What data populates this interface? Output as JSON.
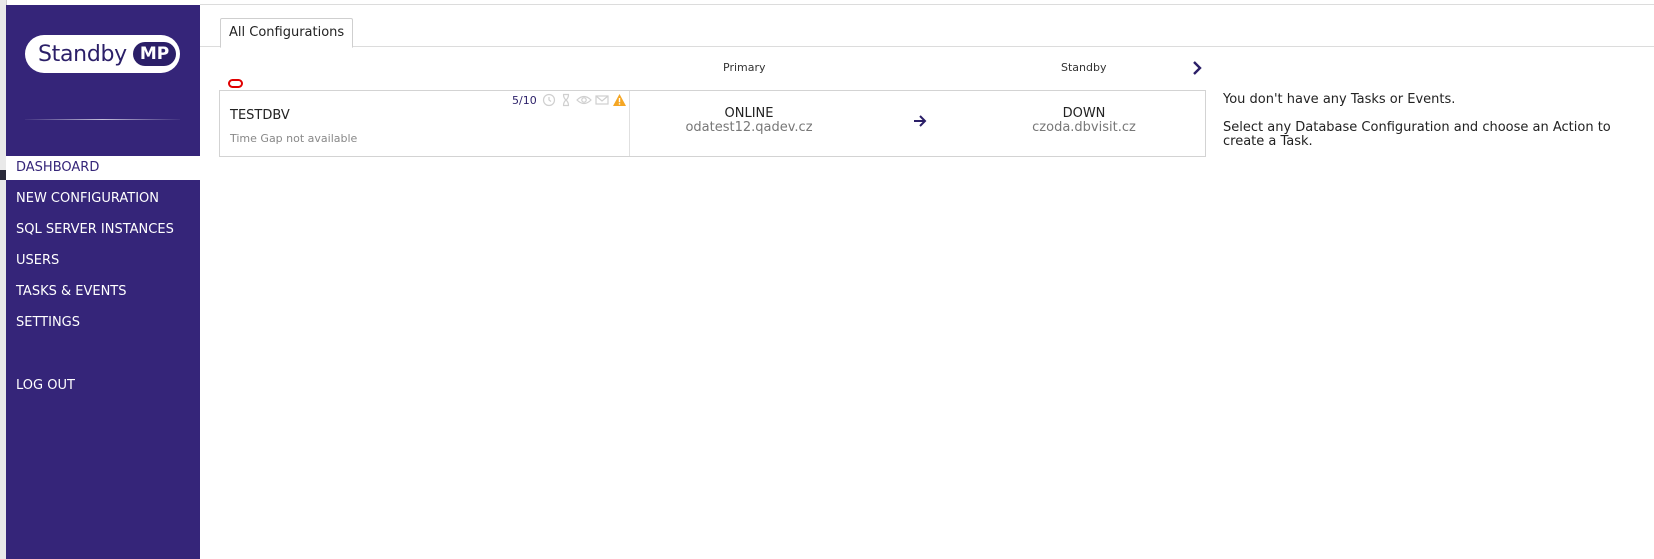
{
  "sidebar": {
    "logo_text": "Standby",
    "logo_badge": "MP",
    "items": [
      {
        "label": "DASHBOARD"
      },
      {
        "label": "NEW CONFIGURATION"
      },
      {
        "label": "SQL SERVER INSTANCES"
      },
      {
        "label": "USERS"
      },
      {
        "label": "TASKS & EVENTS"
      },
      {
        "label": "SETTINGS"
      }
    ],
    "logout_label": "LOG OUT",
    "active_item": "DASHBOARD"
  },
  "tabs": [
    {
      "label": "All Configurations"
    }
  ],
  "columns": {
    "primary": "Primary",
    "standby": "Standby"
  },
  "configuration": {
    "name": "TESTDBV",
    "time_gap": "Time Gap not available",
    "count": "5/10",
    "status_icons": [
      "clock-icon",
      "hourglass-icon",
      "eye-icon",
      "mail-icon",
      "warning-icon"
    ],
    "primary": {
      "status": "ONLINE",
      "host": "odatest12.qadev.cz"
    },
    "standby": {
      "status": "DOWN",
      "host": "czoda.dbvisit.cz"
    }
  },
  "info": {
    "line1": "You don't have any Tasks or Events.",
    "line2": "Select any Database Configuration and choose an Action to create a Task."
  },
  "colors": {
    "sidebar_bg": "#352579",
    "brand_dark": "#2b1f68",
    "warning": "#f5a623",
    "oracle_red": "#e00000"
  }
}
